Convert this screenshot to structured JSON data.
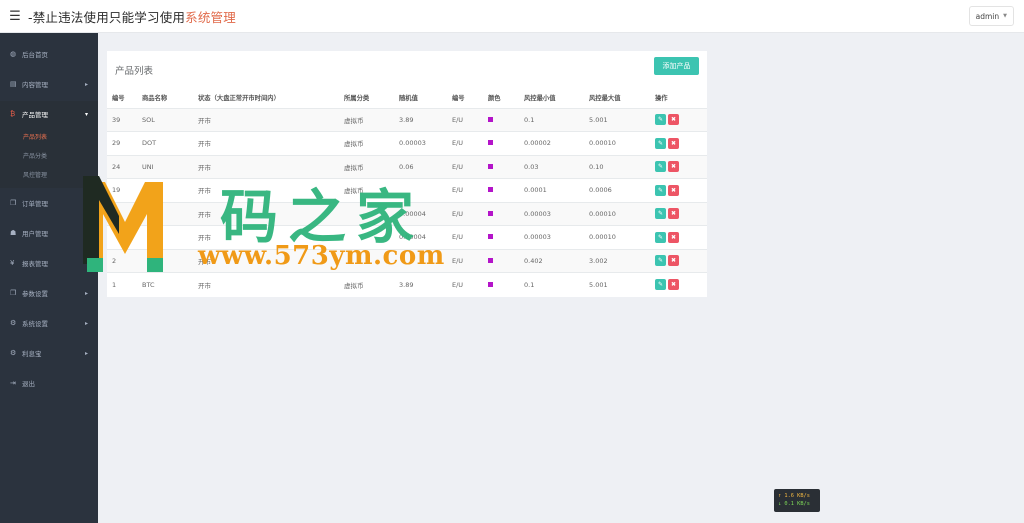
{
  "header": {
    "title_main": "-禁止违法使用只能学习使用",
    "title_accent": "系统管理",
    "user": "admin",
    "menu_icon": "hamburger-icon"
  },
  "sidebar": {
    "items": [
      {
        "label": "后台首页",
        "icon": "dashboard-icon",
        "glyph": "◍"
      },
      {
        "label": "内容管理",
        "icon": "book-icon",
        "glyph": "▤",
        "has_children": true
      },
      {
        "label": "产品管理",
        "icon": "bitcoin-icon",
        "glyph": "₿",
        "has_children": true,
        "active": true
      },
      {
        "label": "订单管理",
        "icon": "copy-icon",
        "glyph": "❐"
      },
      {
        "label": "用户管理",
        "icon": "user-icon",
        "glyph": "☗"
      },
      {
        "label": "报表管理",
        "icon": "yen-icon",
        "glyph": "¥"
      },
      {
        "label": "参数设置",
        "icon": "copy-icon",
        "glyph": "❐",
        "has_children": true
      },
      {
        "label": "系统设置",
        "icon": "cogs-icon",
        "glyph": "⚙",
        "has_children": true
      },
      {
        "label": "利息宝",
        "icon": "cogs-icon",
        "glyph": "⚙",
        "has_children": true
      },
      {
        "label": "退出",
        "icon": "sign-out-icon",
        "glyph": "⇥"
      }
    ],
    "product_sub": [
      "产品列表",
      "产品分类",
      "风控管理"
    ]
  },
  "panel": {
    "title": "产品列表",
    "add_button": "添加产品"
  },
  "table": {
    "headers": [
      "编号",
      "商品名称",
      "状态（大盘正常开市时间内）",
      "所属分类",
      "随机值",
      "编号",
      "颜色",
      "风控最小值",
      "风控最大值",
      "操作"
    ],
    "rows": [
      {
        "id": "39",
        "name": "SOL",
        "status": "开市",
        "category": "虚拟币",
        "random": "3.89",
        "code": "E/U",
        "color": "#b414c9",
        "min": "0.1",
        "max": "5.001"
      },
      {
        "id": "29",
        "name": "DOT",
        "status": "开市",
        "category": "虚拟币",
        "random": "0.00003",
        "code": "E/U",
        "color": "#b414c9",
        "min": "0.00002",
        "max": "0.00010"
      },
      {
        "id": "24",
        "name": "UNI",
        "status": "开市",
        "category": "虚拟币",
        "random": "0.06",
        "code": "E/U",
        "color": "#b414c9",
        "min": "0.03",
        "max": "0.10"
      },
      {
        "id": "19",
        "name": "",
        "status": "开市",
        "category": "虚拟币",
        "random": "",
        "code": "E/U",
        "color": "#b414c9",
        "min": "0.0001",
        "max": "0.0006"
      },
      {
        "id": "",
        "name": "",
        "status": "开市",
        "category": "",
        "random": "0.00004",
        "code": "E/U",
        "color": "#b414c9",
        "min": "0.00003",
        "max": "0.00010"
      },
      {
        "id": "",
        "name": "",
        "status": "开市",
        "category": "",
        "random": "0.00004",
        "code": "E/U",
        "color": "#b414c9",
        "min": "0.00003",
        "max": "0.00010"
      },
      {
        "id": "2",
        "name": "",
        "status": "开市",
        "category": "",
        "random": "",
        "code": "E/U",
        "color": "#b414c9",
        "min": "0.402",
        "max": "3.002"
      },
      {
        "id": "1",
        "name": "BTC",
        "status": "开市",
        "category": "虚拟币",
        "random": "3.89",
        "code": "E/U",
        "color": "#b414c9",
        "min": "0.1",
        "max": "5.001"
      }
    ],
    "action_icons": [
      "pencil-icon",
      "trash-icon"
    ]
  },
  "watermark": {
    "cn": "码之家",
    "url": "www.573ym.com",
    "logo_letter": "M"
  },
  "network": {
    "up": "↑ 1.6 KB/s",
    "down": "↓ 0.1 KB/s"
  },
  "colors": {
    "accent": "#3cc4b1",
    "danger": "#ed5565",
    "sidebar_bg": "#2b333e",
    "brand_accent": "#e16a4a"
  }
}
